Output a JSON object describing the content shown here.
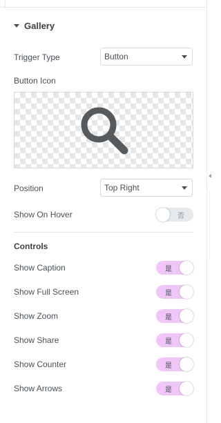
{
  "section": {
    "title": "Gallery",
    "caret_icon": "caret-down-icon"
  },
  "trigger_type": {
    "label": "Trigger Type",
    "value": "Button"
  },
  "button_icon": {
    "label": "Button Icon",
    "icon": "search-icon",
    "icon_color": "#555a5e"
  },
  "position": {
    "label": "Position",
    "value": "Top Right"
  },
  "show_on_hover": {
    "label": "Show On Hover",
    "state": "off",
    "toggle_text": "否"
  },
  "controls": {
    "heading": "Controls",
    "items": [
      {
        "label": "Show Caption",
        "state": "on",
        "toggle_text": "是"
      },
      {
        "label": "Show Full Screen",
        "state": "on",
        "toggle_text": "是"
      },
      {
        "label": "Show Zoom",
        "state": "on",
        "toggle_text": "是"
      },
      {
        "label": "Show Share",
        "state": "on",
        "toggle_text": "是"
      },
      {
        "label": "Show Counter",
        "state": "on",
        "toggle_text": "是"
      },
      {
        "label": "Show Arrows",
        "state": "on",
        "toggle_text": "是"
      }
    ]
  },
  "colors": {
    "toggle_on": "#f0c6f8",
    "toggle_off": "#e6e9ec",
    "text": "#495157"
  }
}
